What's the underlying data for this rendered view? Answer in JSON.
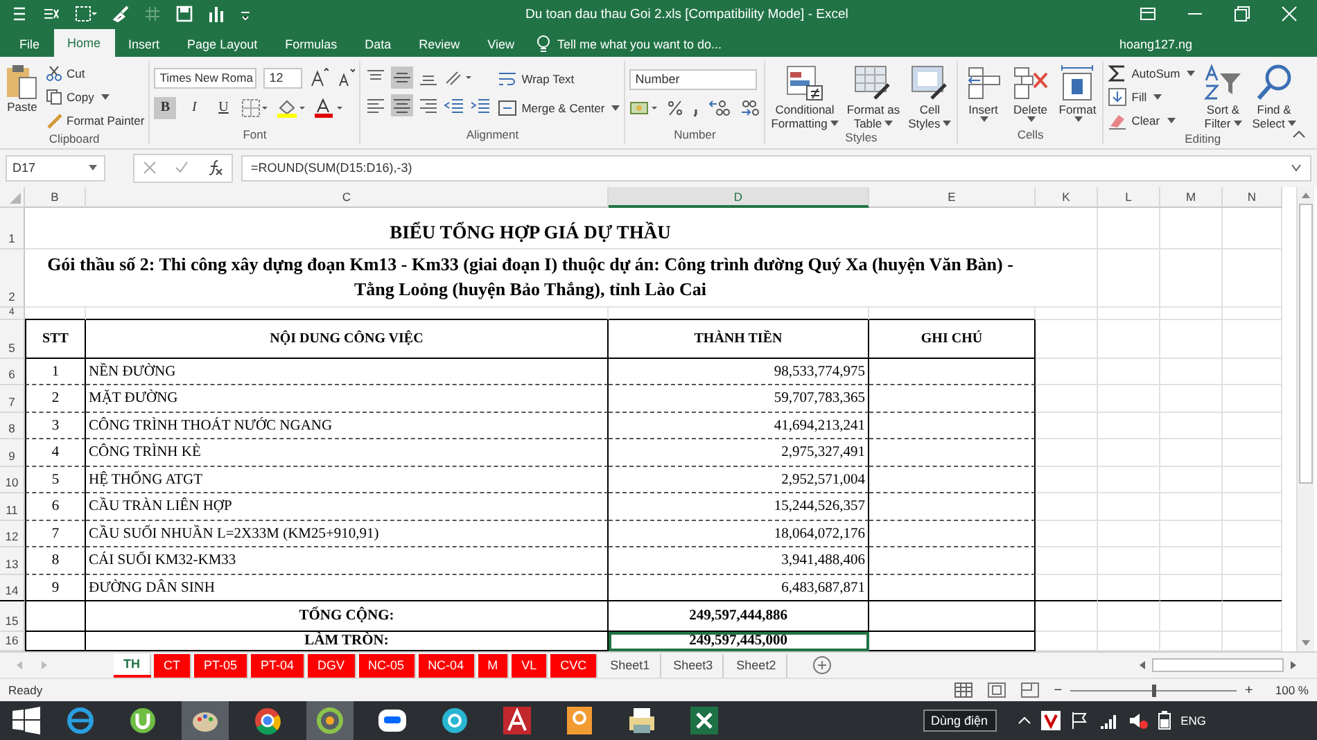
{
  "window": {
    "title": "Du toan dau thau Goi 2.xls  [Compatibility Mode] - Excel"
  },
  "ribbon_tabs": [
    {
      "label": "File",
      "selected": false
    },
    {
      "label": "Home",
      "selected": true
    },
    {
      "label": "Insert",
      "selected": false
    },
    {
      "label": "Page Layout",
      "selected": false
    },
    {
      "label": "Formulas",
      "selected": false
    },
    {
      "label": "Data",
      "selected": false
    },
    {
      "label": "Review",
      "selected": false
    },
    {
      "label": "View",
      "selected": false
    }
  ],
  "tell_me": "Tell me what you want to do...",
  "account": "hoang127.ng",
  "ribbon": {
    "clipboard": {
      "label": "Clipboard",
      "paste": "Paste",
      "cut": "Cut",
      "copy": "Copy",
      "format_painter": "Format Painter"
    },
    "font": {
      "label": "Font",
      "family": "Times New Roma",
      "size": "12",
      "toggles": [
        {
          "kind": "bold",
          "label": "B",
          "on": true
        },
        {
          "kind": "italic",
          "label": "I",
          "on": false
        },
        {
          "kind": "underline",
          "label": "U",
          "on": false
        }
      ]
    },
    "alignment": {
      "label": "Alignment",
      "wrap_text": "Wrap Text",
      "merge_center": "Merge & Center",
      "center_on": true
    },
    "number": {
      "label": "Number",
      "format": "Number"
    },
    "styles": {
      "label": "Styles",
      "buttons": [
        [
          "Conditional",
          "Formatting"
        ],
        [
          "Format as",
          "Table"
        ],
        [
          "Cell",
          "Styles"
        ]
      ]
    },
    "cells": {
      "label": "Cells",
      "buttons": [
        "Insert",
        "Delete",
        "Format"
      ]
    },
    "editing": {
      "label": "Editing",
      "autosum": "AutoSum",
      "fill": "Fill",
      "clear": "Clear",
      "sort": [
        "Sort &",
        "Filter"
      ],
      "find": [
        "Find &",
        "Select"
      ]
    }
  },
  "name_box": "D17",
  "formula": "=ROUND(SUM(D15:D16),-3)",
  "columns": [
    {
      "label": "B",
      "selected": false
    },
    {
      "label": "C",
      "selected": false
    },
    {
      "label": "D",
      "selected": true
    },
    {
      "label": "E",
      "selected": false
    },
    {
      "label": "K",
      "selected": false
    },
    {
      "label": "L",
      "selected": false
    },
    {
      "label": "M",
      "selected": false
    },
    {
      "label": "N",
      "selected": false
    }
  ],
  "sheet": {
    "title": {
      "row": "1",
      "text": "BIỂU TỔNG HỢP GIÁ DỰ THẦU"
    },
    "subtitle": {
      "row": "2",
      "lines": [
        "Gói thầu số 2: Thi công xây dựng đoạn Km13 - Km33 (giai đoạn I) thuộc dự án: Công trình đường Quý Xa (huyện Văn Bàn) -",
        "Tằng Loỏng (huyện Bảo Thắng), tỉnh Lào Cai"
      ]
    },
    "spacer_row": "4",
    "header": {
      "row": "5",
      "cells": [
        "STT",
        "NỘI DUNG CÔNG VIỆC",
        "THÀNH TIỀN",
        "GHI CHÚ"
      ]
    },
    "items": [
      {
        "row": "6",
        "stt": "1",
        "content": "NỀN ĐƯỜNG",
        "amount": "98,533,774,975"
      },
      {
        "row": "7",
        "stt": "2",
        "content": "MẶT ĐƯỜNG",
        "amount": "59,707,783,365"
      },
      {
        "row": "8",
        "stt": "3",
        "content": "CÔNG TRÌNH THOÁT NƯỚC NGANG",
        "amount": "41,694,213,241"
      },
      {
        "row": "9",
        "stt": "4",
        "content": "CÔNG TRÌNH KÈ",
        "amount": "2,975,327,491"
      },
      {
        "row": "10",
        "stt": "5",
        "content": "HỆ THỐNG ATGT",
        "amount": "2,952,571,004"
      },
      {
        "row": "11",
        "stt": "6",
        "content": "CẦU TRÀN LIÊN HỢP",
        "amount": "15,244,526,357"
      },
      {
        "row": "12",
        "stt": "7",
        "content": "CẦU SUỐI NHUẦN L=2X33M (KM25+910,91)",
        "amount": "18,064,072,176"
      },
      {
        "row": "13",
        "stt": "8",
        "content": "CÁI SUỐI KM32-KM33",
        "amount": "3,941,488,406"
      },
      {
        "row": "14",
        "stt": "9",
        "content": "ĐƯỜNG DÂN SINH",
        "amount": "6,483,687,871"
      }
    ],
    "totals": [
      {
        "row": "15",
        "label": "TỔNG CỘNG:",
        "amount": "249,597,444,886",
        "selected": false
      },
      {
        "row": "16",
        "label": "LÀM TRÒN:",
        "amount": "249,597,445,000",
        "selected": true
      }
    ]
  },
  "sheet_tabs": [
    {
      "label": "TH",
      "selected": true,
      "color": "#ff0000"
    },
    {
      "label": "CT",
      "selected": false,
      "color": "#ff0000"
    },
    {
      "label": "PT-05",
      "selected": false,
      "color": "#ff0000"
    },
    {
      "label": "PT-04",
      "selected": false,
      "color": "#ff0000"
    },
    {
      "label": "DGV",
      "selected": false,
      "color": "#ff0000"
    },
    {
      "label": "NC-05",
      "selected": false,
      "color": "#ff0000"
    },
    {
      "label": "NC-04",
      "selected": false,
      "color": "#ff0000"
    },
    {
      "label": "M",
      "selected": false,
      "color": "#ff0000"
    },
    {
      "label": "VL",
      "selected": false,
      "color": "#ff0000"
    },
    {
      "label": "CVC",
      "selected": false,
      "color": "#ff0000"
    },
    {
      "label": "Sheet1",
      "selected": false
    },
    {
      "label": "Sheet3",
      "selected": false
    },
    {
      "label": "Sheet2",
      "selected": false
    }
  ],
  "status_bar": {
    "status": "Ready",
    "zoom_out": "−",
    "zoom_in": "+",
    "zoom": "100 %",
    "zoom_level": {
      "level": 0.5
    }
  },
  "taskbar": {
    "tooltip": "Dùng điện",
    "language": "ENG"
  }
}
